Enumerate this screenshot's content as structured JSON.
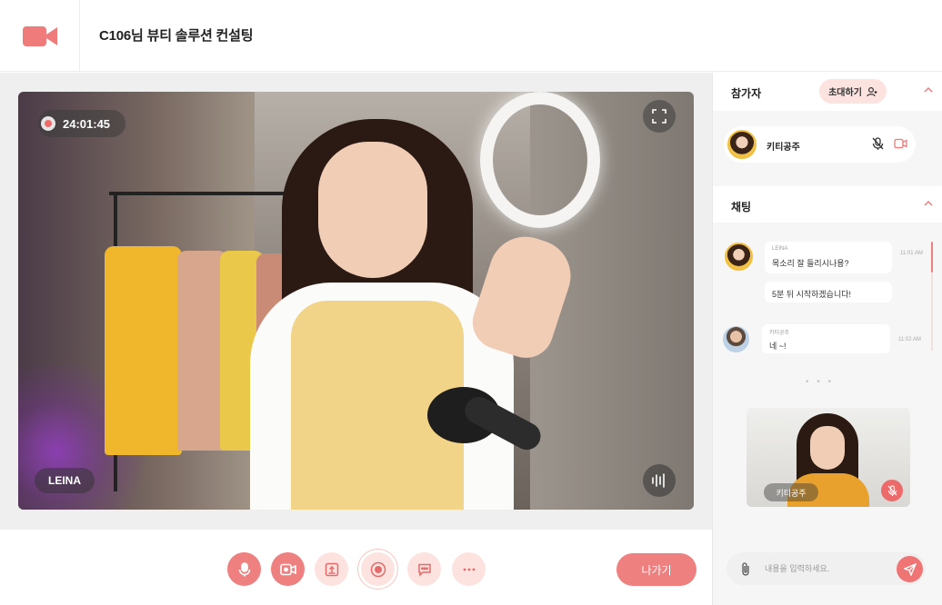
{
  "header": {
    "title": "C106님 뷰티 솔루션 컨설팅",
    "logo_icon": "video-camera-icon",
    "accent_color": "#ef7b7b"
  },
  "video": {
    "recording_time": "24:01:45",
    "speaker_name": "LEINA",
    "fullscreen_icon": "fullscreen-icon",
    "audio_icon": "audio-wave-icon"
  },
  "toolbar": {
    "buttons": [
      {
        "icon": "microphone-icon"
      },
      {
        "icon": "video-camera-icon"
      },
      {
        "icon": "share-screen-icon"
      },
      {
        "icon": "record-icon"
      },
      {
        "icon": "chat-icon"
      },
      {
        "icon": "more-icon"
      }
    ],
    "leave_label": "나가기"
  },
  "participants": {
    "title": "참가자",
    "invite_label": "초대하기",
    "list": [
      {
        "name": "키티공주",
        "mic": "muted",
        "camera": "on"
      }
    ]
  },
  "chat": {
    "title": "채팅",
    "messages": [
      {
        "sender": "LEINA",
        "text": "목소리 잘 들리시나용?",
        "time": "11:01 AM"
      },
      {
        "sender": "",
        "text": "5분 뒤 시작하겠습니다!",
        "time": ""
      },
      {
        "sender": "키티공주",
        "text": "네 ~!",
        "time": "11:02 AM"
      }
    ],
    "more_indicator": "• • •"
  },
  "pip": {
    "name": "키티공주"
  },
  "composer": {
    "placeholder": "내용을 입력하세요.",
    "attach_icon": "paperclip-icon",
    "send_icon": "send-icon"
  }
}
